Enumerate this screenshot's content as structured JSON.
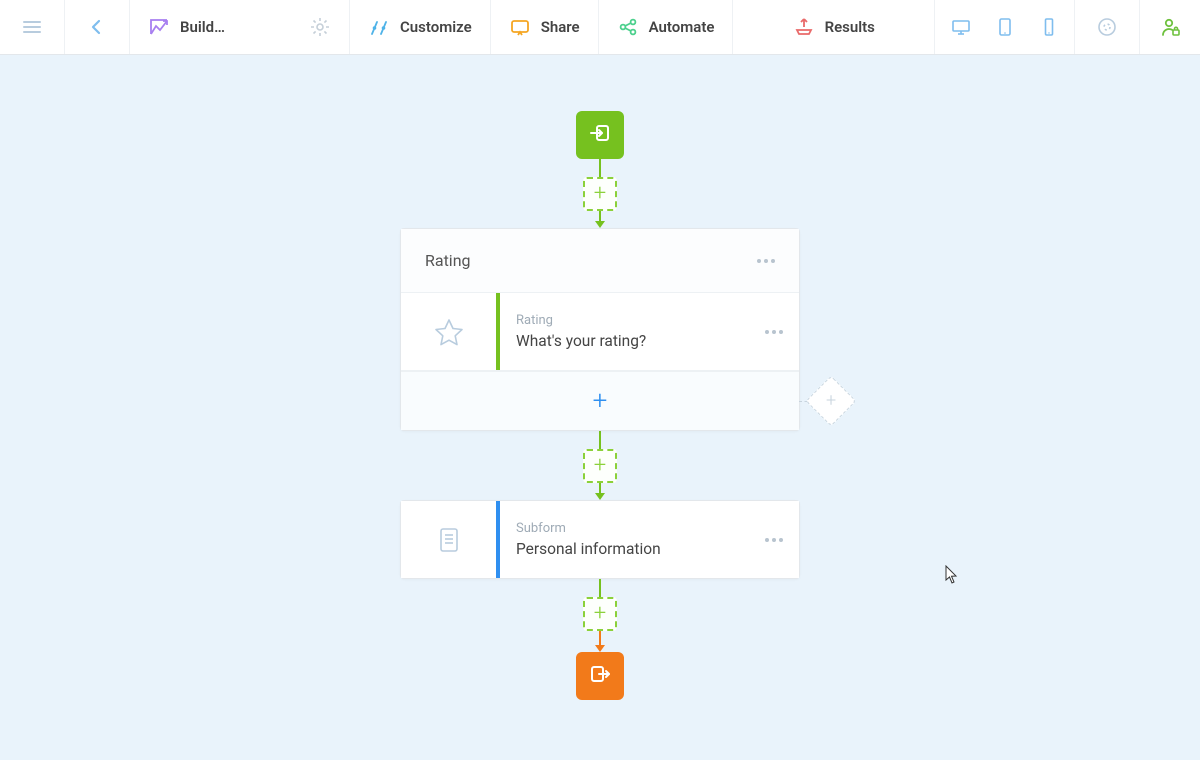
{
  "toolbar": {
    "build_label": "Build…",
    "customize_label": "Customize",
    "share_label": "Share",
    "automate_label": "Automate",
    "results_label": "Results"
  },
  "flow": {
    "card1": {
      "title": "Rating",
      "row_type": "Rating",
      "row_title": "What's your rating?"
    },
    "card2": {
      "row_type": "Subform",
      "row_title": "Personal information"
    }
  },
  "colors": {
    "start": "#76c11f",
    "end": "#f27a1a",
    "accent_blue": "#2f8ff0"
  }
}
